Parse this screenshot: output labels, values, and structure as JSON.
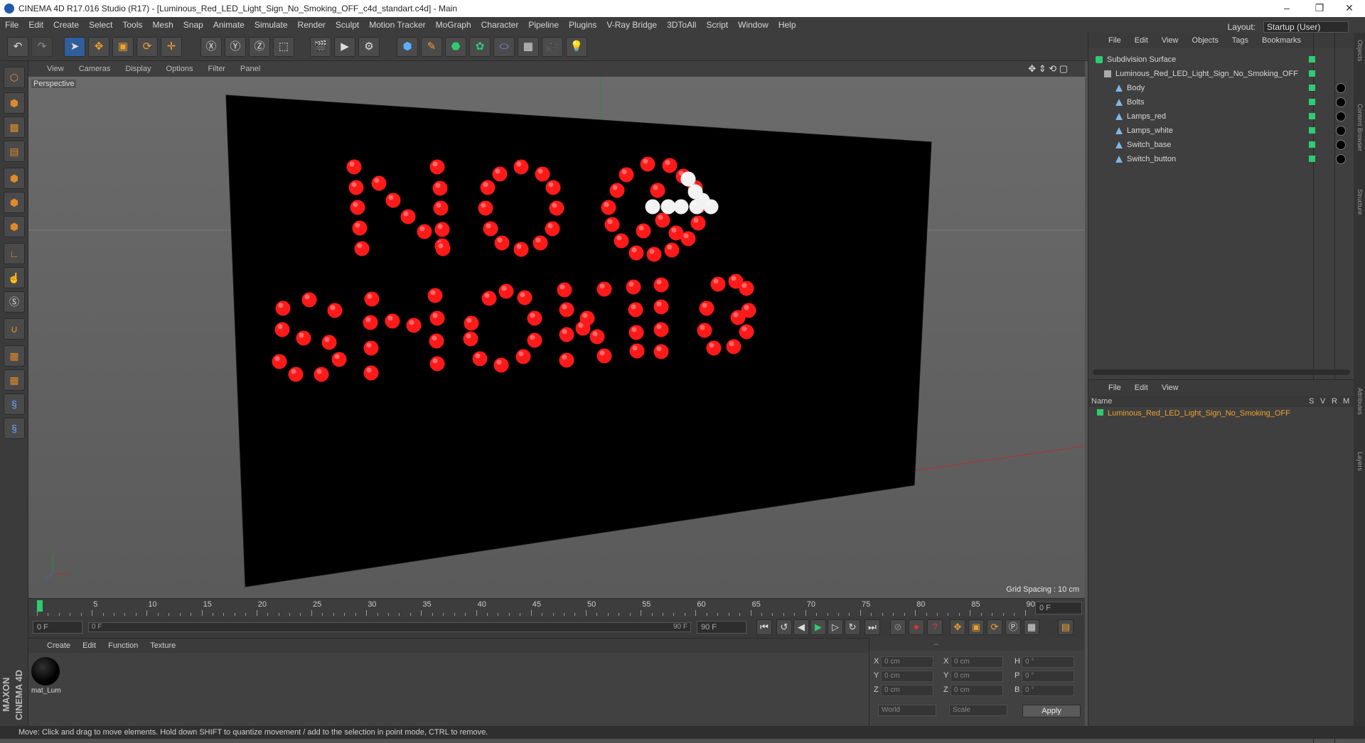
{
  "title": "CINEMA 4D R17.016 Studio (R17) - [Luminous_Red_LED_Light_Sign_No_Smoking_OFF_c4d_standart.c4d] - Main",
  "menu": [
    "File",
    "Edit",
    "Create",
    "Select",
    "Tools",
    "Mesh",
    "Snap",
    "Animate",
    "Simulate",
    "Render",
    "Sculpt",
    "Motion Tracker",
    "MoGraph",
    "Character",
    "Pipeline",
    "Plugins",
    "V-Ray Bridge",
    "3DToAll",
    "Script",
    "Window",
    "Help"
  ],
  "layout": {
    "label": "Layout:",
    "value": "Startup (User)"
  },
  "viewport": {
    "menu": [
      "View",
      "Cameras",
      "Display",
      "Options",
      "Filter",
      "Panel"
    ],
    "label": "Perspective",
    "grid": "Grid Spacing : 10 cm",
    "sign_text": "NO SMOKING"
  },
  "timeline": {
    "ticks": [
      "0",
      "5",
      "10",
      "15",
      "20",
      "25",
      "30",
      "35",
      "40",
      "45",
      "50",
      "55",
      "60",
      "65",
      "70",
      "75",
      "80",
      "85",
      "90"
    ],
    "end": "0 F"
  },
  "playback": {
    "start": "0 F",
    "range_start": "0 F",
    "range_end": "90 F",
    "max": "90 F"
  },
  "materials": {
    "menu": [
      "Create",
      "Edit",
      "Function",
      "Texture"
    ],
    "item": "mat_Lum"
  },
  "coords": {
    "rows": [
      {
        "a": "X",
        "v1": "0 cm",
        "b": "X",
        "v2": "0 cm",
        "c": "H",
        "v3": "0 °"
      },
      {
        "a": "Y",
        "v1": "0 cm",
        "b": "Y",
        "v2": "0 cm",
        "c": "P",
        "v3": "0 °"
      },
      {
        "a": "Z",
        "v1": "0 cm",
        "b": "Z",
        "v2": "0 cm",
        "c": "B",
        "v3": "0 °"
      }
    ],
    "world": "World",
    "scale": "Scale",
    "apply": "Apply",
    "header": "--"
  },
  "objects": {
    "menu": [
      "File",
      "Edit",
      "View",
      "Objects",
      "Tags",
      "Bookmarks"
    ],
    "items": [
      {
        "name": "Subdivision Surface"
      },
      {
        "name": "Luminous_Red_LED_Light_Sign_No_Smoking_OFF"
      },
      {
        "name": "Body"
      },
      {
        "name": "Bolts"
      },
      {
        "name": "Lamps_red"
      },
      {
        "name": "Lamps_white"
      },
      {
        "name": "Switch_base"
      },
      {
        "name": "Switch_button"
      }
    ]
  },
  "attributes": {
    "menu": [
      "File",
      "Edit",
      "View"
    ],
    "col_name": "Name",
    "cols": [
      "S",
      "V",
      "R",
      "M"
    ],
    "item": "Luminous_Red_LED_Light_Sign_No_Smoking_OFF"
  },
  "status": "Move: Click and drag to move elements. Hold down SHIFT to quantize movement / add to the selection in point mode, CTRL to remove.",
  "brand": "MAXON CINEMA 4D",
  "colors": {
    "led_red": "#ff1a1a",
    "led_white": "#f2f2f2",
    "selection": "#f0a030",
    "tag_green": "#2ecc71"
  },
  "right_tabs": [
    "Objects",
    "Content Browser",
    "Structure",
    "Attributes",
    "Layers"
  ]
}
